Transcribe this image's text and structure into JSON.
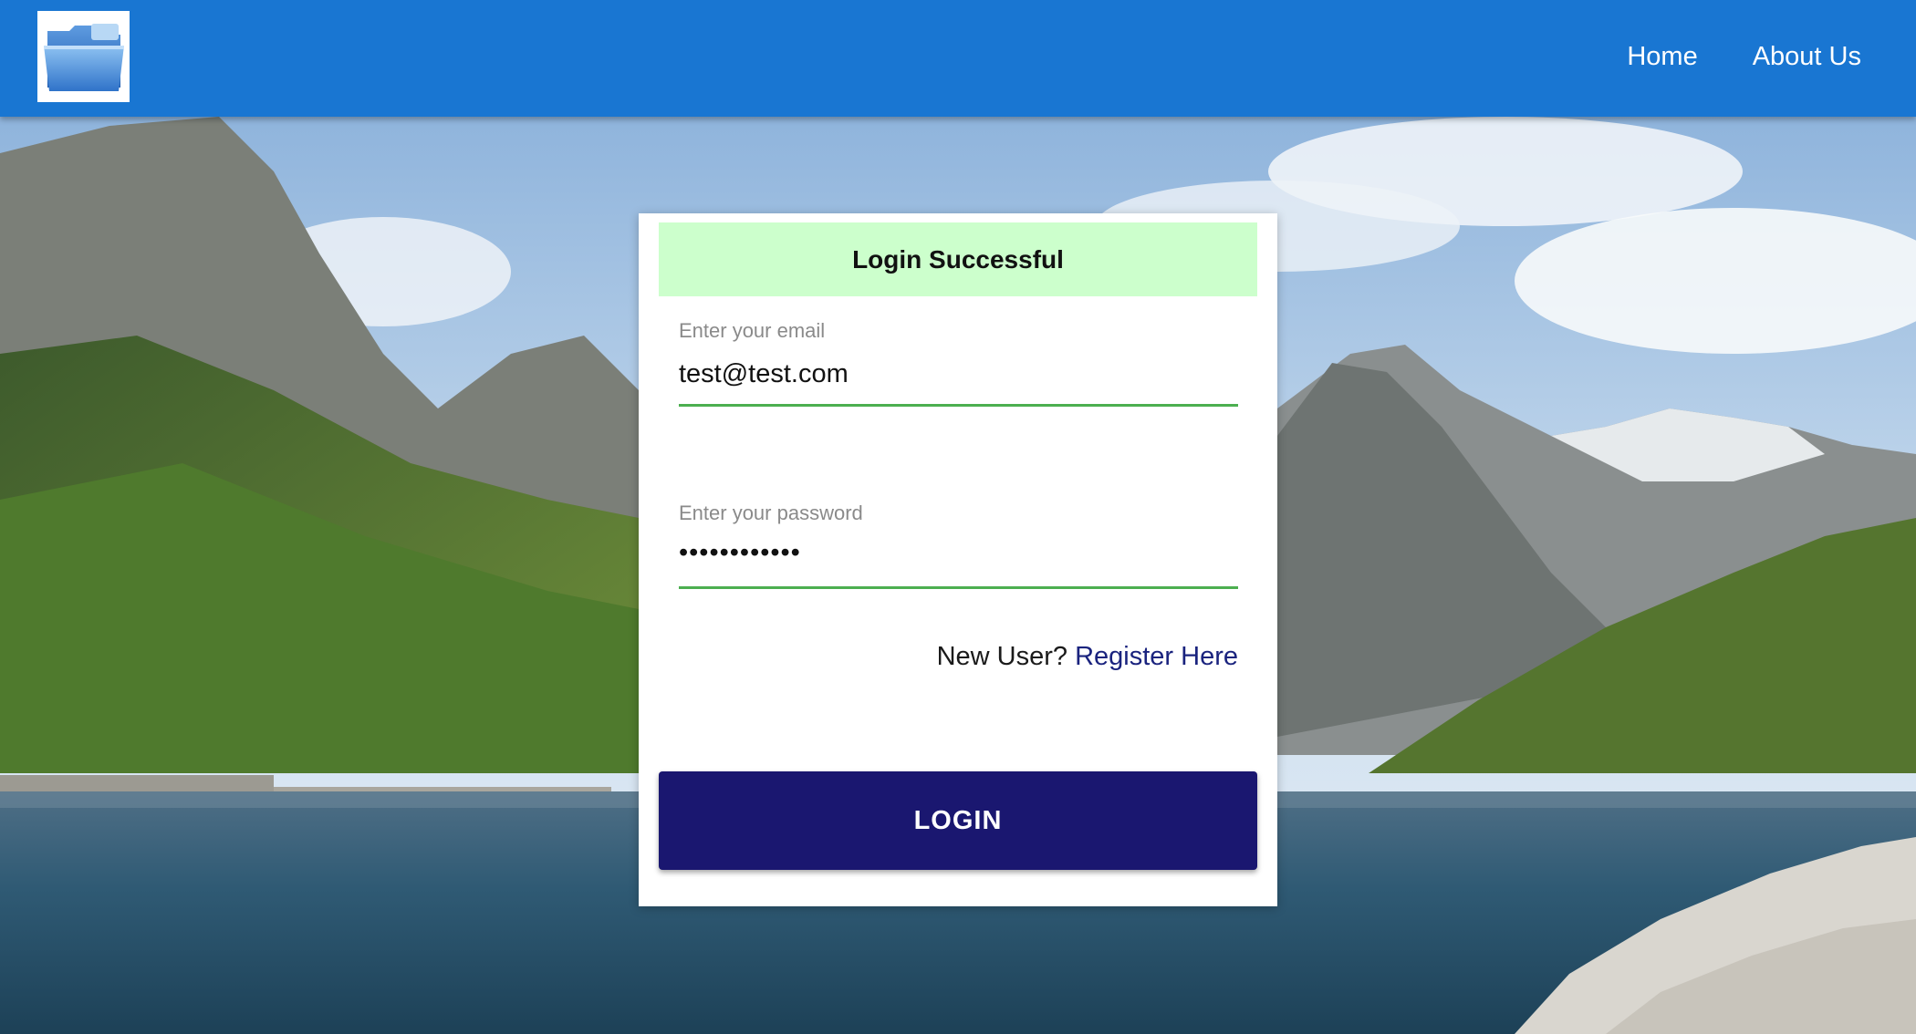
{
  "header": {
    "logo_icon": "folder-icon",
    "nav": [
      {
        "label": "Home"
      },
      {
        "label": "About Us"
      }
    ],
    "color": "#1976d2"
  },
  "login_card": {
    "status_message": "Login Successful",
    "status_color": "#ccffcc",
    "email": {
      "label": "Enter your email",
      "value": "test@test.com"
    },
    "password": {
      "label": "Enter your password",
      "value": "••••••••••••"
    },
    "register_prompt": "New User?",
    "register_link": "Register Here",
    "login_button": "LOGIN",
    "button_color": "#1a1770",
    "field_accent": "#4caf50"
  },
  "background": {
    "scene": "mountain-lake-photo"
  }
}
